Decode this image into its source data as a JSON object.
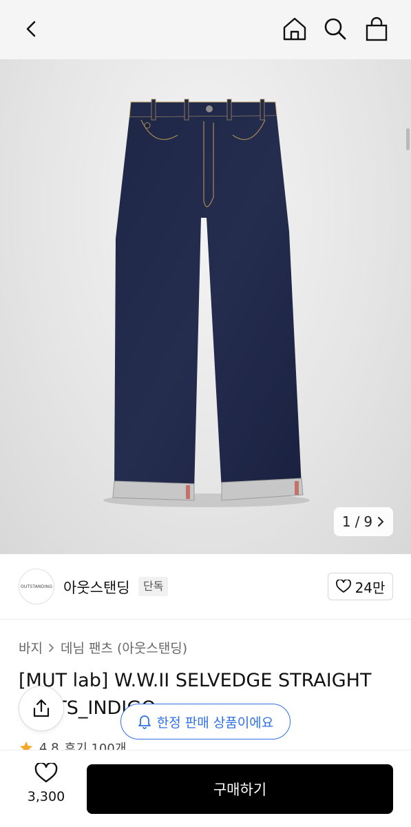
{
  "header": {
    "icons": [
      "chevron-left-icon",
      "home-icon",
      "search-icon",
      "shopping-bag-icon"
    ]
  },
  "gallery": {
    "pager": {
      "current": "1",
      "separator": "/",
      "total": "9"
    }
  },
  "brand": {
    "logo_text": "OUTSTANDING",
    "name": "아웃스탠딩",
    "badge": "단독",
    "likes": "24만"
  },
  "product": {
    "breadcrumb": [
      "바지",
      "데님 팬츠 (아웃스탠딩)"
    ],
    "title": "[MUT lab] W.W.II SELVEDGE STRAIGHT PANTS_INDIGO",
    "rating": "4.8",
    "review_label": "후기 100개"
  },
  "notice": {
    "limited_label": "한정 판매 상품이에요"
  },
  "bottom_bar": {
    "wish_count": "3,300",
    "buy_label": "구매하기"
  },
  "colors": {
    "accent_blue": "#2f6fe8",
    "buy_button": "#000000",
    "star": "#f5a623"
  }
}
